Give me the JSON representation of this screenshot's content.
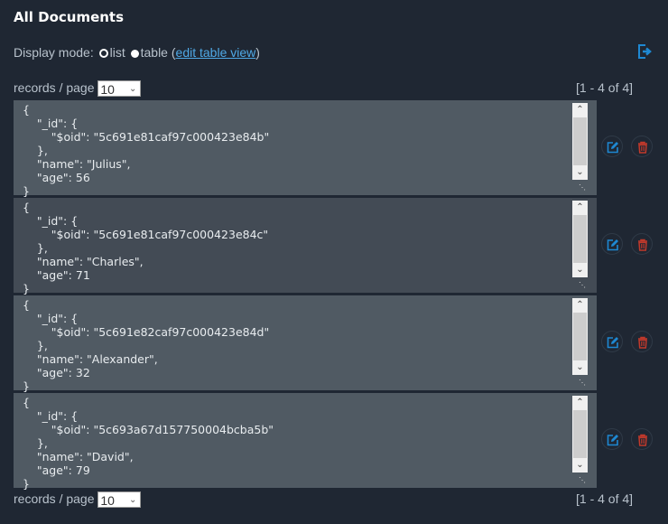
{
  "header": {
    "title": "All Documents"
  },
  "display_mode": {
    "label": "Display mode:",
    "options": [
      "list",
      "table"
    ],
    "selected": "list",
    "open_paren": "(",
    "link": "edit table view",
    "close_paren": ")"
  },
  "pagination": {
    "label": "records / page",
    "value": "10",
    "range": "[1 - 4 of 4]"
  },
  "documents": [
    {
      "text": "{\n    \"_id\": {\n        \"$oid\": \"5c691e81caf97c000423e84b\"\n    },\n    \"name\": \"Julius\",\n    \"age\": 56\n}"
    },
    {
      "text": "{\n    \"_id\": {\n        \"$oid\": \"5c691e81caf97c000423e84c\"\n    },\n    \"name\": \"Charles\",\n    \"age\": 71\n}"
    },
    {
      "text": "{\n    \"_id\": {\n        \"$oid\": \"5c691e82caf97c000423e84d\"\n    },\n    \"name\": \"Alexander\",\n    \"age\": 32\n}"
    },
    {
      "text": "{\n    \"_id\": {\n        \"$oid\": \"5c693a67d157750004bcba5b\"\n    },\n    \"name\": \"David\",\n    \"age\": 79\n}"
    }
  ],
  "colors": {
    "background": "#1f2733",
    "doc_bg": "#505a63",
    "doc_bg_alt": "#434b55",
    "accent": "#1e88d2",
    "delete": "#c0392b"
  },
  "icons": {
    "export": "export-icon",
    "edit": "edit-icon",
    "delete": "trash-icon"
  }
}
